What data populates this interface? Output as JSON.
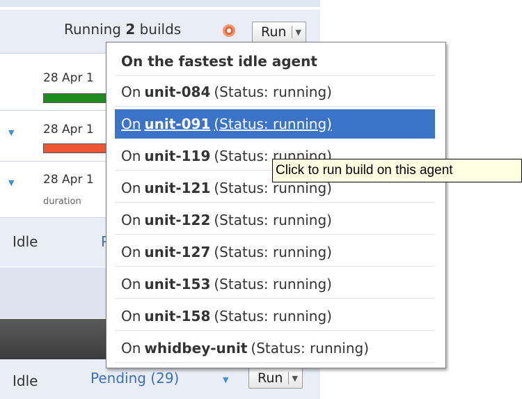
{
  "header": {
    "running_prefix": "Running",
    "running_count": "2",
    "running_suffix": "builds",
    "run_label": "Run"
  },
  "builds": [
    {
      "date": "28 Apr 1",
      "status_color": "#1d8c1d",
      "has_bar": true,
      "duration": ""
    },
    {
      "date": "28 Apr 1",
      "status_color": "#ee5533",
      "has_bar": true,
      "duration": ""
    },
    {
      "date": "28 Apr 1",
      "status_color": "",
      "has_bar": false,
      "duration": "duration"
    }
  ],
  "idle_rows": [
    {
      "label": "Idle",
      "pending": "P"
    },
    {
      "label": "Idle",
      "pending": "Pending (29)",
      "run_label": "Run"
    }
  ],
  "menu": {
    "header": "On the fastest idle agent",
    "items": [
      {
        "prefix": "On",
        "name": "unit-084",
        "status": "(Status: running)"
      },
      {
        "prefix": "On",
        "name": "unit-091",
        "status": "(Status: running)",
        "selected": true
      },
      {
        "prefix": "On",
        "name": "unit-119",
        "status": "(Status: running)"
      },
      {
        "prefix": "On",
        "name": "unit-121",
        "status": "(Status: running)"
      },
      {
        "prefix": "On",
        "name": "unit-122",
        "status": "(Status: running)"
      },
      {
        "prefix": "On",
        "name": "unit-127",
        "status": "(Status: running)"
      },
      {
        "prefix": "On",
        "name": "unit-153",
        "status": "(Status: running)"
      },
      {
        "prefix": "On",
        "name": "unit-158",
        "status": "(Status: running)"
      },
      {
        "prefix": "On",
        "name": "whidbey-unit",
        "status": "(Status: running)"
      }
    ]
  },
  "tooltip": "Click to run build on this agent",
  "colors": {
    "accent": "#3a73c8",
    "link": "#3a6ec2",
    "success": "#1d8c1d",
    "failure": "#ee5533"
  }
}
